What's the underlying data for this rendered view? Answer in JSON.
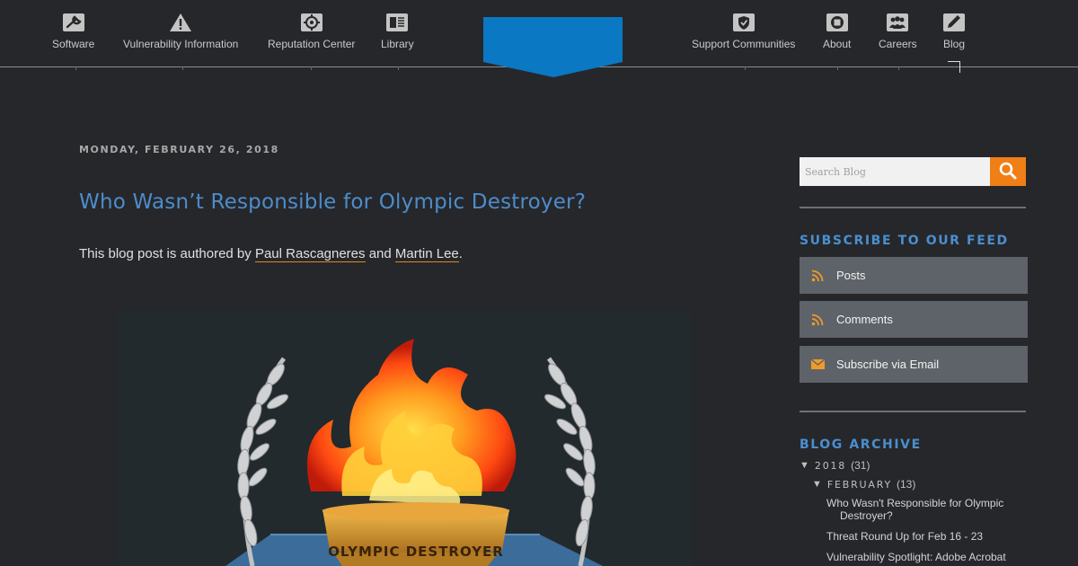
{
  "nav": {
    "left_items": [
      {
        "label": "Software",
        "icon": "wrench-icon"
      },
      {
        "label": "Vulnerability Information",
        "icon": "warning-icon"
      },
      {
        "label": "Reputation Center",
        "icon": "crosshair-icon"
      },
      {
        "label": "Library",
        "icon": "book-icon"
      }
    ],
    "right_items": [
      {
        "label": "Support Communities",
        "icon": "shield-check-icon"
      },
      {
        "label": "About",
        "icon": "circle-square-icon"
      },
      {
        "label": "Careers",
        "icon": "people-icon"
      },
      {
        "label": "Blog",
        "icon": "pencil-icon"
      }
    ],
    "logo_color": "#0a78c2"
  },
  "post": {
    "date": "MONDAY, FEBRUARY 26, 2018",
    "title": "Who Wasn’t Responsible for Olympic Destroyer?",
    "byline_prefix": "This blog post is authored by ",
    "author1": "Paul Rascagneres",
    "byline_and": " and ",
    "author2": "Martin Lee",
    "byline_suffix": ".",
    "hero_caption": "OLYMPIC DESTROYER"
  },
  "sidebar": {
    "search_placeholder": "Search Blog",
    "subscribe_heading": "SUBSCRIBE TO OUR FEED",
    "feeds": [
      {
        "label": "Posts",
        "icon": "rss-icon"
      },
      {
        "label": "Comments",
        "icon": "rss-icon"
      },
      {
        "label": "Subscribe via Email",
        "icon": "envelope-icon"
      }
    ],
    "archive_heading": "BLOG ARCHIVE",
    "archive": {
      "year": "2018",
      "year_count": "(31)",
      "month": "FEBRUARY",
      "month_count": "(13)",
      "posts": [
        {
          "line1": "Who Wasn't Responsible for Olympic",
          "line2": "Destroyer?"
        },
        {
          "line1": "Threat Round Up for Feb 16 - 23",
          "line2": ""
        },
        {
          "line1": "Vulnerability Spotlight: Adobe Acrobat",
          "line2": ""
        }
      ]
    },
    "accent_color": "#f07f16"
  }
}
